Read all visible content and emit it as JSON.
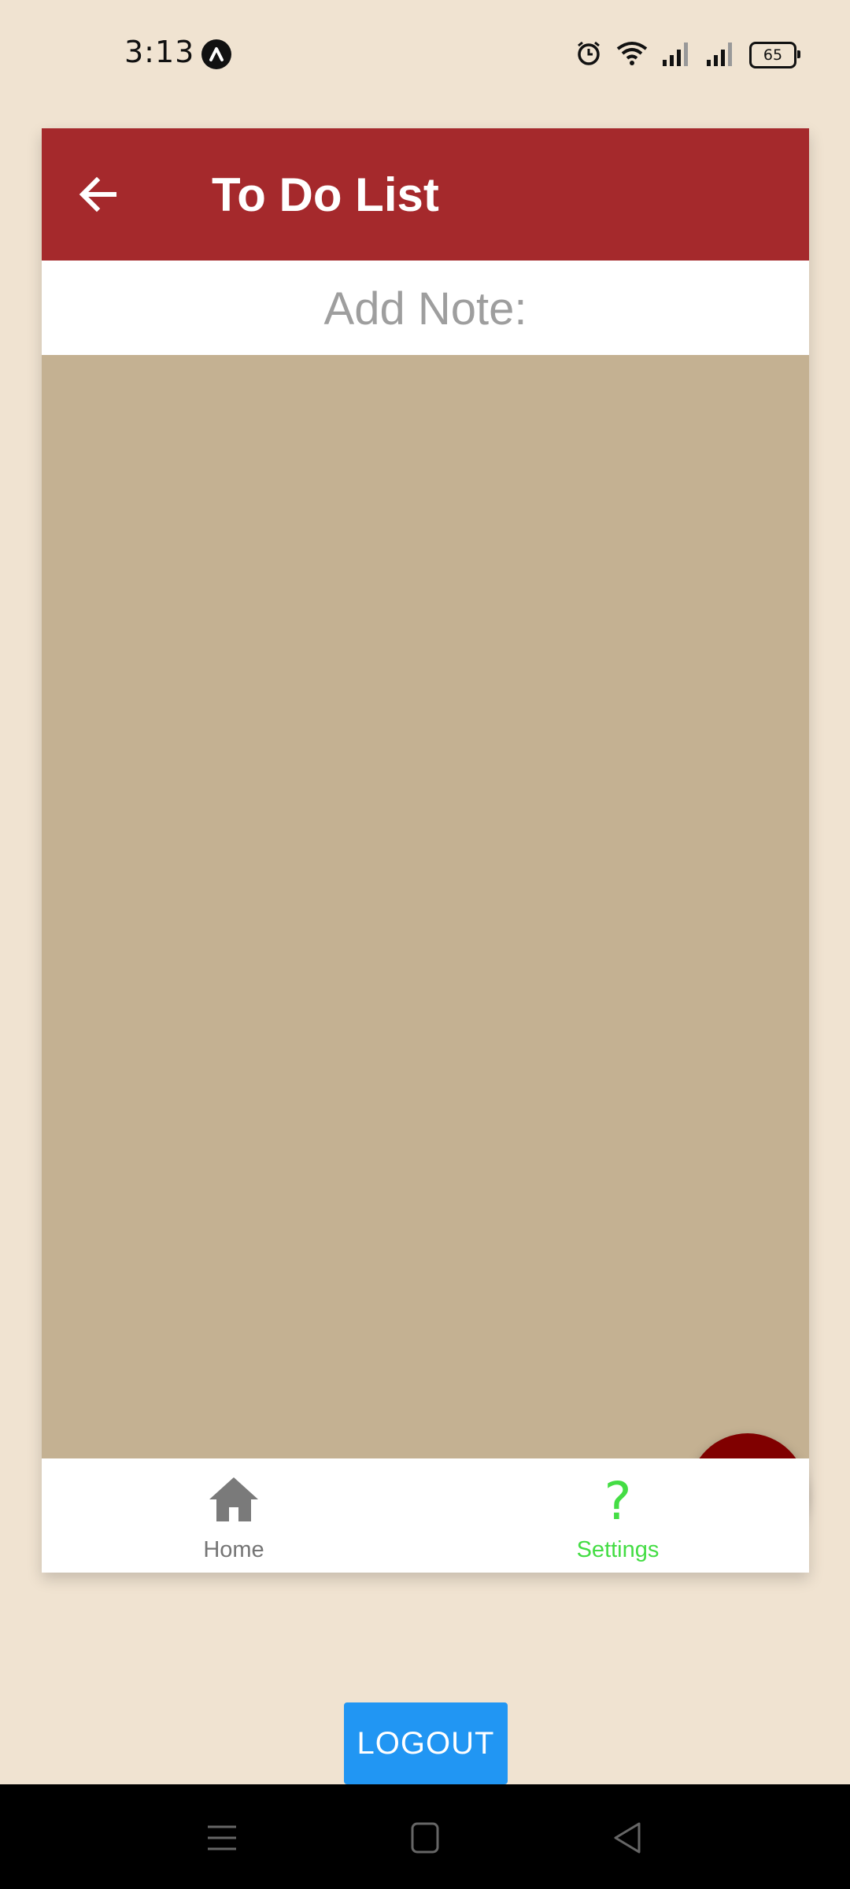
{
  "status_bar": {
    "time": "3:13",
    "battery": "65",
    "icons": [
      "app-notification-icon",
      "alarm-icon",
      "wifi-icon",
      "signal-icon",
      "signal-icon",
      "battery-icon"
    ]
  },
  "header": {
    "title": "To Do List",
    "back_icon": "back-arrow-icon",
    "background": "#A5292C"
  },
  "note_bar": {
    "label": "Add Note:"
  },
  "content": {
    "background": "#C4B192"
  },
  "fab": {
    "icon": "plus-icon",
    "color": "#800000"
  },
  "tabs": [
    {
      "label": "Home",
      "icon": "home-icon",
      "color": "#757575"
    },
    {
      "label": "Settings",
      "icon": "question-mark-icon",
      "glyph": "?",
      "color": "#44DD44"
    }
  ],
  "logout": {
    "label": "LOGOUT",
    "color": "#2196F3"
  },
  "system_nav": {
    "icons": [
      "menu-icon",
      "home-square-icon",
      "back-triangle-icon"
    ]
  }
}
